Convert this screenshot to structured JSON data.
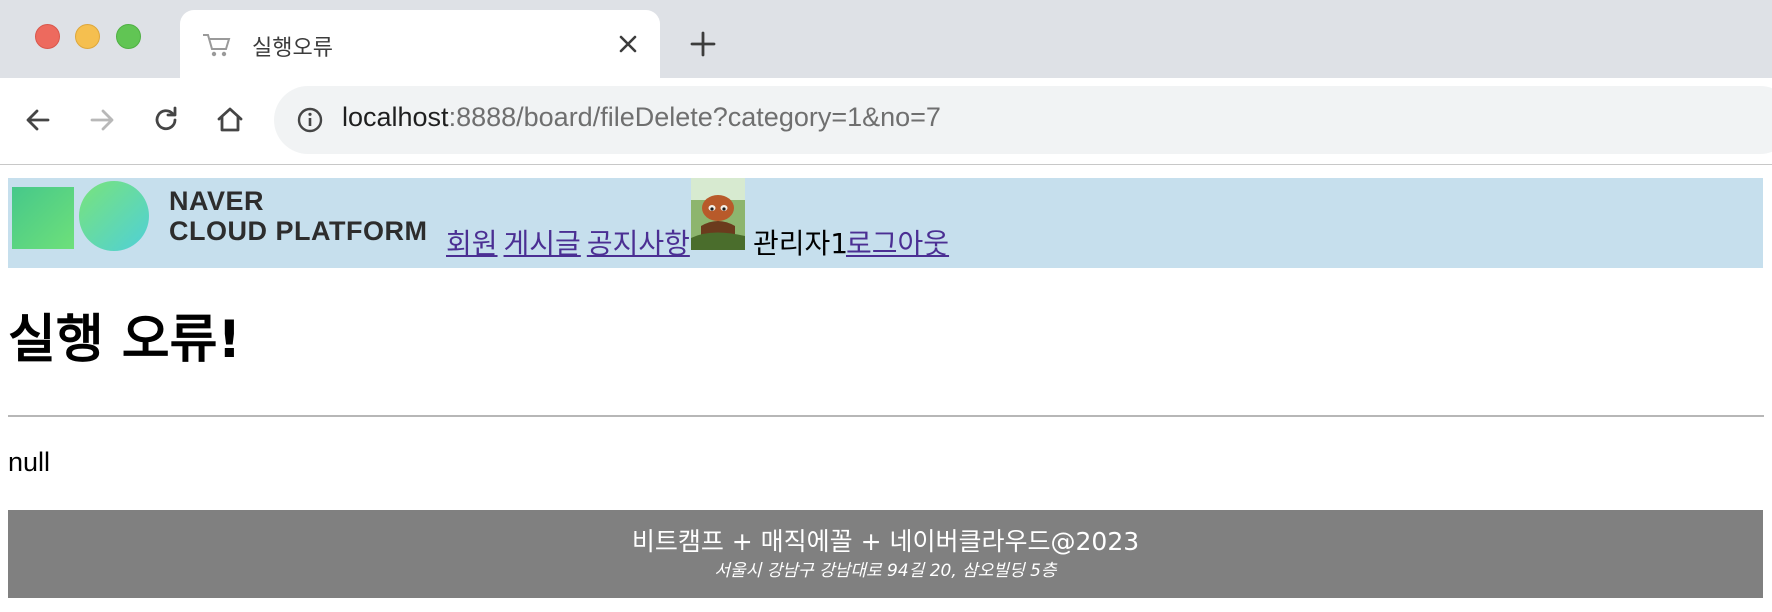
{
  "browser": {
    "tab": {
      "title": "실행오류",
      "icon": "cart-icon",
      "close_icon": "close-icon"
    },
    "new_tab_icon": "plus-icon",
    "toolbar": {
      "back_icon": "back-arrow-icon",
      "forward_icon": "forward-arrow-icon",
      "reload_icon": "reload-icon",
      "home_icon": "home-icon",
      "info_icon": "info-icon"
    },
    "url": {
      "host": "localhost",
      "rest": ":8888/board/fileDelete?category=1&no=7"
    },
    "traffic_lights": [
      "#ed6a5e",
      "#f5bf4f",
      "#61c554"
    ]
  },
  "header": {
    "background": "#c6dfed",
    "logo": {
      "line1": "NAVER",
      "line2": "CLOUD PLATFORM"
    },
    "nav": [
      {
        "label": "회원"
      },
      {
        "label": "게시글"
      },
      {
        "label": "공지사항"
      }
    ],
    "user_name": "관리자1",
    "logout_label": "로그아웃"
  },
  "main": {
    "title": "실행 오류!",
    "message": "null"
  },
  "footer": {
    "background": "#808080",
    "line1": "비트캠프 + 매직에꼴 + 네이버클라우드@2023",
    "line2": "서울시 강남구 강남대로 94길 20, 삼오빌딩 5층"
  }
}
